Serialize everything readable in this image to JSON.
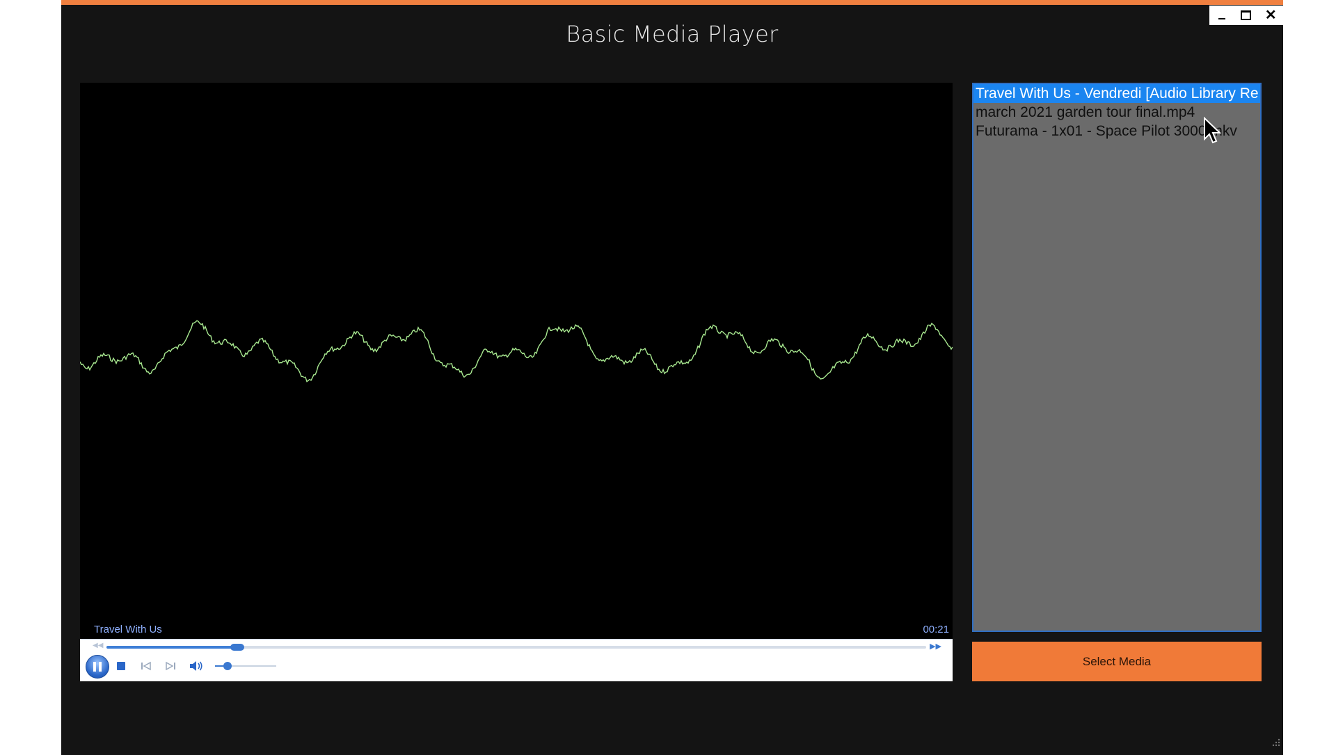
{
  "window": {
    "title": "Basic Media Player",
    "controls": {
      "minimize_icon": "minimize-icon",
      "maximize_icon": "maximize-icon",
      "close_icon": "close-icon"
    }
  },
  "colors": {
    "window_bg": "#141414",
    "accent": "#f08040",
    "waveform": "#a8e890",
    "playlist_bg": "#6b6b6b",
    "playlist_selected": "#1b85f0",
    "button_bg": "#f07a38"
  },
  "player": {
    "now_playing": "Travel With Us",
    "elapsed": "00:21",
    "seek_progress": 0.16,
    "volume_level": 0.2,
    "state": "playing"
  },
  "playlist": {
    "items": [
      {
        "label": "Travel With Us - Vendredi [Audio Library Re",
        "selected": true
      },
      {
        "label": "march 2021 garden tour final.mp4",
        "selected": false
      },
      {
        "label": "Futurama - 1x01 - Space Pilot 3000.mkv",
        "selected": false
      }
    ]
  },
  "buttons": {
    "select_media": "Select Media"
  }
}
